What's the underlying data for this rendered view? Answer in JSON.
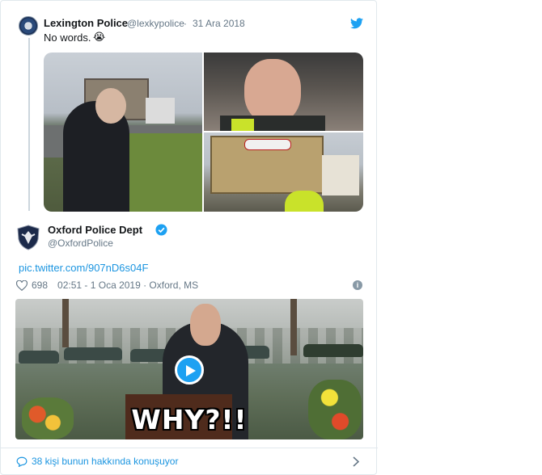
{
  "quoted_tweet": {
    "name": "Lexington Police",
    "handle": "@lexkypolice",
    "separator": "·",
    "date": "31 Ara 2018",
    "text": "No words.",
    "emoji": "😭"
  },
  "tweet": {
    "name": "Oxford Police Dept",
    "handle": "@OxfordPolice",
    "link": "pic.twitter.com/907nD6s04F",
    "likes": "698",
    "timestamp": "02:51 - 1 Oca 2019 · Oxford, MS",
    "info_glyph": "i",
    "video_caption": "WHY?!!"
  },
  "footer": {
    "conversation": "38 kişi bunun hakkında konuşuyor"
  },
  "colors": {
    "link": "#1b95e0",
    "twitter_blue": "#1da1f2",
    "muted": "#657786",
    "border": "#e1e8ed"
  },
  "icons": [
    "twitter-bird-icon",
    "verified-badge-icon",
    "heart-icon",
    "info-icon",
    "play-icon",
    "comment-icon",
    "chevron-right-icon"
  ]
}
